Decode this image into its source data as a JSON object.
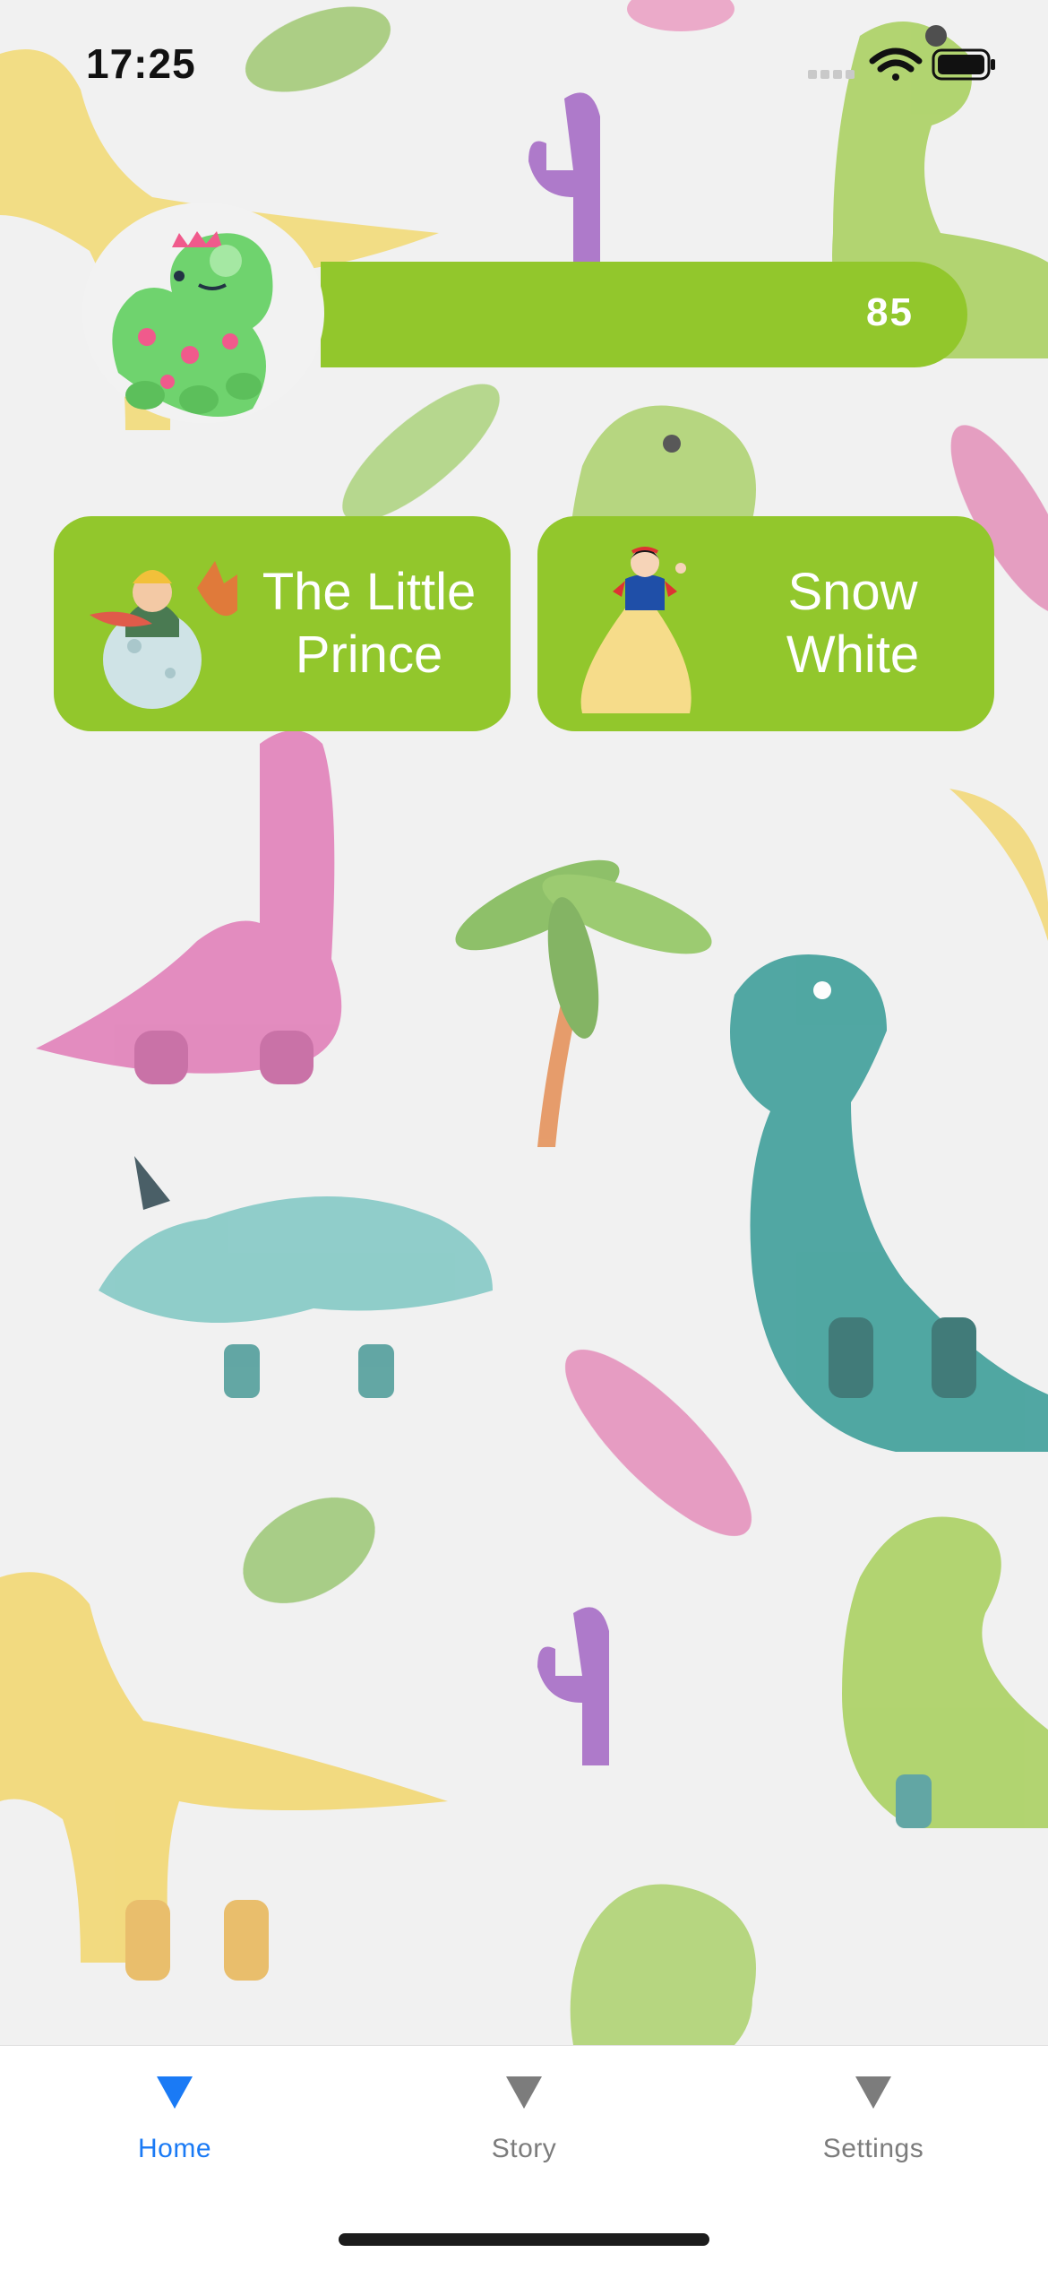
{
  "status_bar": {
    "time": "17:25",
    "icons": [
      "signal-icon",
      "wifi-icon",
      "battery-icon"
    ]
  },
  "profile": {
    "avatar_icon": "dinosaur-avatar-icon",
    "score": "85"
  },
  "stories": [
    {
      "title_line1": "The Little",
      "title_line2": "Prince",
      "icon": "little-prince-illustration"
    },
    {
      "title_line1": "Snow",
      "title_line2": "White",
      "icon": "snow-white-illustration"
    }
  ],
  "tab_bar": {
    "tabs": [
      {
        "label": "Home",
        "icon": "triangle-down-icon",
        "active": true
      },
      {
        "label": "Story",
        "icon": "triangle-down-icon",
        "active": false
      },
      {
        "label": "Settings",
        "icon": "triangle-down-icon",
        "active": false
      }
    ]
  },
  "colors": {
    "accent_green": "#92c72c",
    "tab_active": "#1a7af5",
    "tab_inactive": "#7c7c7c",
    "background": "#f1f1f1"
  }
}
